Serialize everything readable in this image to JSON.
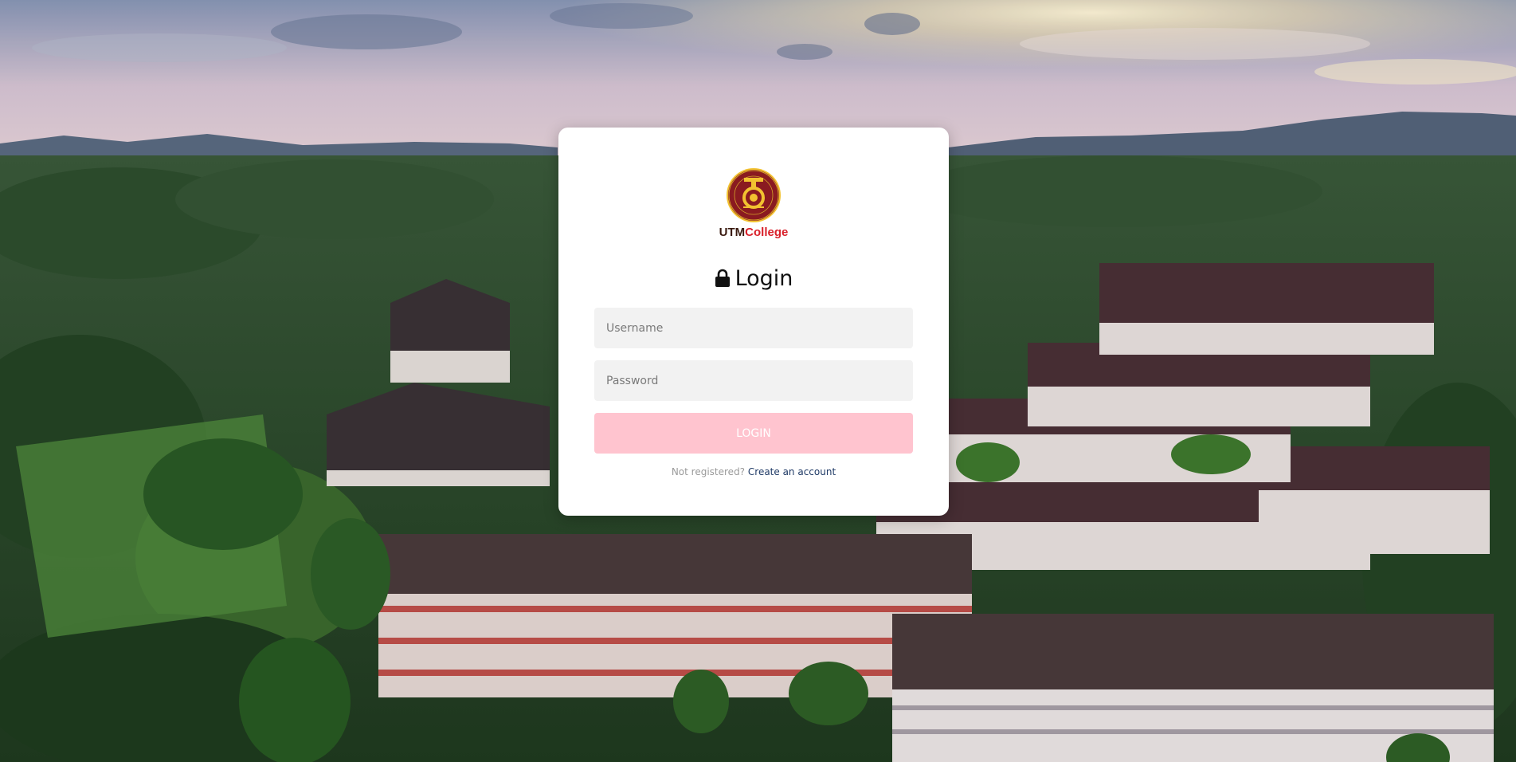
{
  "brand": {
    "name_part1": "UTM",
    "name_part2": "College",
    "color_part1": "#3a1a10",
    "color_part2": "#d9202a"
  },
  "form": {
    "title": "Login",
    "title_icon": "lock-icon",
    "username_placeholder": "Username",
    "username_value": "",
    "password_placeholder": "Password",
    "password_value": "",
    "submit_label": "LOGIN",
    "submit_color": "#ffc4cf"
  },
  "register": {
    "prompt": "Not registered?",
    "link_label": "Create an account"
  },
  "background": {
    "description_icon": "campus-aerial-photo"
  }
}
